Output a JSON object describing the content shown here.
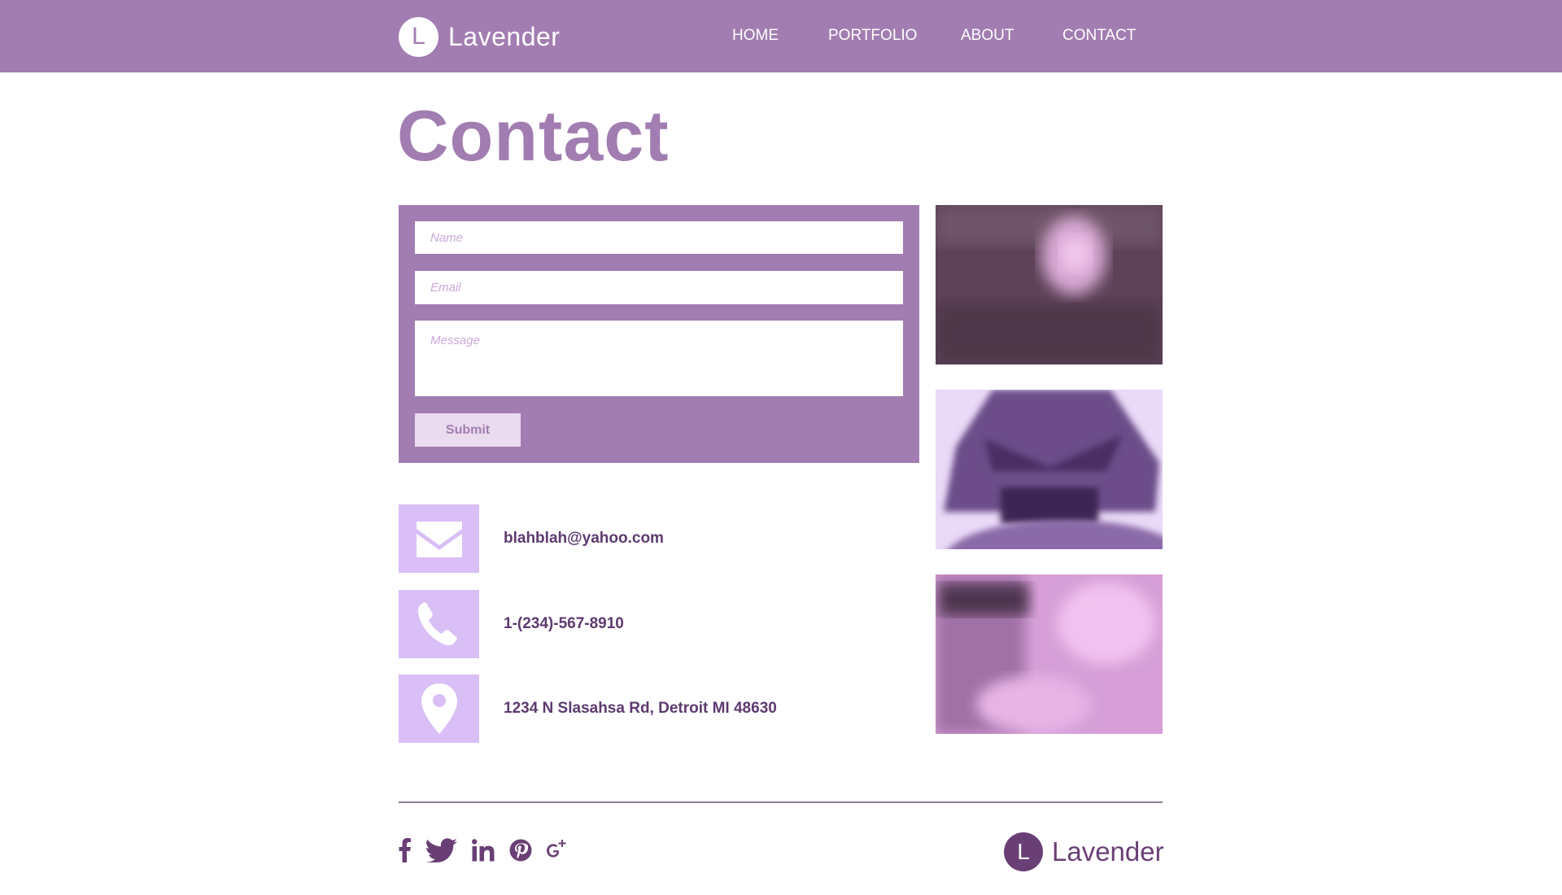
{
  "header": {
    "logo_letter": "L",
    "brand": "Lavender",
    "nav": [
      "HOME",
      "PORTFOLIO",
      "ABOUT",
      "CONTACT"
    ]
  },
  "page": {
    "title": "Contact"
  },
  "form": {
    "name_placeholder": "Name",
    "email_placeholder": "Email",
    "message_placeholder": "Message",
    "submit_label": "Submit"
  },
  "contact_info": {
    "email": "blahblah@yahoo.com",
    "phone": "1-(234)-567-8910",
    "address": "1234 N Slasahsa Rd, Detroit MI 48630"
  },
  "thumbnails": [
    "blurred-flower-photo",
    "blurred-purple-figure-photo",
    "blurred-pink-poster-photo"
  ],
  "footer": {
    "socials": [
      "facebook-icon",
      "twitter-icon",
      "linkedin-icon",
      "pinterest-icon",
      "google-plus-icon"
    ],
    "logo_letter": "L",
    "brand": "Lavender"
  },
  "colors": {
    "primary": "#a27db1",
    "accent_light": "#d9bff5",
    "text_dark": "#5d3a6f",
    "footer_brand": "#6a3f75"
  }
}
